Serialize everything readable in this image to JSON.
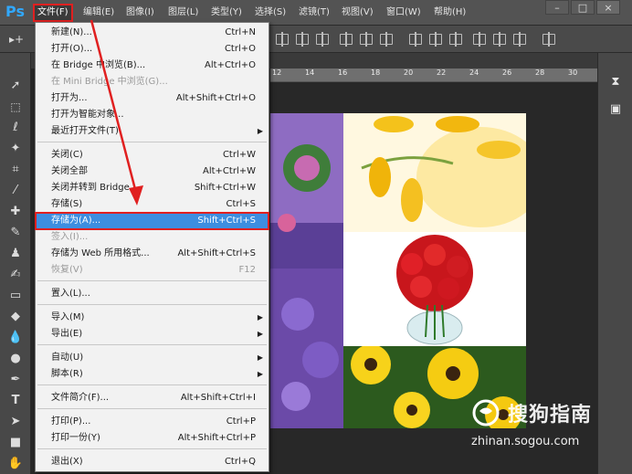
{
  "menubar": {
    "logo": "Ps",
    "items": [
      "文件(F)",
      "编辑(E)",
      "图像(I)",
      "图层(L)",
      "类型(Y)",
      "选择(S)",
      "滤镜(T)",
      "视图(V)",
      "窗口(W)",
      "帮助(H)"
    ],
    "active": "文件(F)",
    "window_buttons": [
      "–",
      "□",
      "×"
    ]
  },
  "file_menu": {
    "items": [
      {
        "label": "新建(N)...",
        "shortcut": "Ctrl+N",
        "enabled": true
      },
      {
        "label": "打开(O)...",
        "shortcut": "Ctrl+O",
        "enabled": true
      },
      {
        "label": "在 Bridge 中浏览(B)...",
        "shortcut": "Alt+Ctrl+O",
        "enabled": true
      },
      {
        "label": "在 Mini Bridge 中浏览(G)...",
        "shortcut": "",
        "enabled": false
      },
      {
        "label": "打开为...",
        "shortcut": "Alt+Shift+Ctrl+O",
        "enabled": true
      },
      {
        "label": "打开为智能对象...",
        "shortcut": "",
        "enabled": true
      },
      {
        "label": "最近打开文件(T)",
        "shortcut": "",
        "enabled": true,
        "submenu": true
      },
      {
        "label": "关闭(C)",
        "shortcut": "Ctrl+W",
        "enabled": true
      },
      {
        "label": "关闭全部",
        "shortcut": "Alt+Ctrl+W",
        "enabled": true
      },
      {
        "label": "关闭并转到 Bridge...",
        "shortcut": "Shift+Ctrl+W",
        "enabled": true
      },
      {
        "label": "存储(S)",
        "shortcut": "Ctrl+S",
        "enabled": true
      },
      {
        "label": "存储为(A)...",
        "shortcut": "Shift+Ctrl+S",
        "enabled": true,
        "highlighted": true
      },
      {
        "label": "签入(I)...",
        "shortcut": "",
        "enabled": false
      },
      {
        "label": "存储为 Web 所用格式...",
        "shortcut": "Alt+Shift+Ctrl+S",
        "enabled": true
      },
      {
        "label": "恢复(V)",
        "shortcut": "F12",
        "enabled": false
      },
      {
        "label": "置入(L)...",
        "shortcut": "",
        "enabled": true
      },
      {
        "label": "导入(M)",
        "shortcut": "",
        "enabled": true,
        "submenu": true
      },
      {
        "label": "导出(E)",
        "shortcut": "",
        "enabled": true,
        "submenu": true
      },
      {
        "label": "自动(U)",
        "shortcut": "",
        "enabled": true,
        "submenu": true
      },
      {
        "label": "脚本(R)",
        "shortcut": "",
        "enabled": true,
        "submenu": true
      },
      {
        "label": "文件简介(F)...",
        "shortcut": "Alt+Shift+Ctrl+I",
        "enabled": true
      },
      {
        "label": "打印(P)...",
        "shortcut": "Ctrl+P",
        "enabled": true
      },
      {
        "label": "打印一份(Y)",
        "shortcut": "Alt+Shift+Ctrl+P",
        "enabled": true
      },
      {
        "label": "退出(X)",
        "shortcut": "Ctrl+Q",
        "enabled": true
      }
    ]
  },
  "ruler": {
    "ticks": [
      "12",
      "14",
      "16",
      "18",
      "20",
      "22",
      "24",
      "26",
      "28",
      "30"
    ]
  },
  "watermark": {
    "brand": "搜狗指南",
    "url": "zhinan.sogou.com"
  },
  "colors": {
    "accent": "#3d8ee0",
    "annotation": "#e02020",
    "ps_blue": "#31a8ff"
  }
}
